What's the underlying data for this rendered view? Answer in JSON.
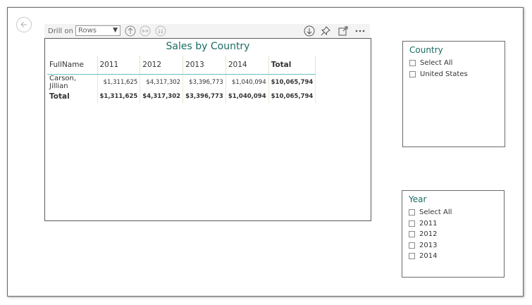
{
  "toolbar": {
    "drill_label": "Drill on",
    "drill_value": "Rows",
    "icons": [
      "drill-up-icon",
      "expand-all-icon",
      "drill-down-icon",
      "download-icon",
      "pin-icon",
      "focus-mode-icon",
      "more-options-icon"
    ]
  },
  "visual": {
    "title": "Sales by Country",
    "headers": [
      "FullName",
      "2011",
      "2012",
      "2013",
      "2014",
      "Total"
    ],
    "rows": [
      {
        "name": "Carson, Jillian",
        "values": [
          "$1,311,625",
          "$4,317,302",
          "$3,396,773",
          "$1,040,094",
          "$10,065,794"
        ]
      }
    ],
    "total_row": {
      "name": "Total",
      "values": [
        "$1,311,625",
        "$4,317,302",
        "$3,396,773",
        "$1,040,094",
        "$10,065,794"
      ]
    }
  },
  "country_slicer": {
    "title": "Country",
    "items": [
      "Select All",
      "United States"
    ]
  },
  "year_slicer": {
    "title": "Year",
    "items": [
      "Select All",
      "2011",
      "2012",
      "2013",
      "2014"
    ]
  },
  "colors": {
    "accent": "#1a6c63",
    "header_line": "#6cc0c0"
  }
}
